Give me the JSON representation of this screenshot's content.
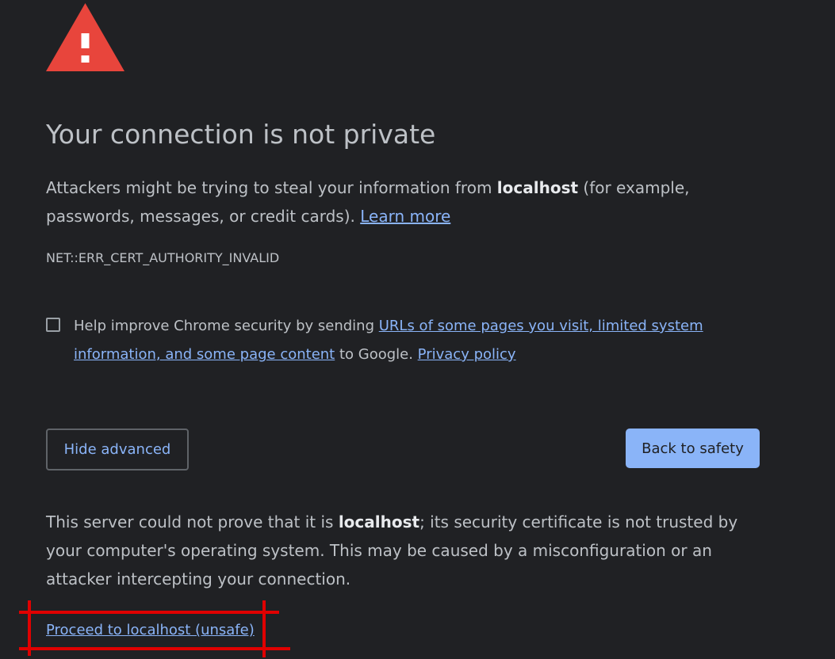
{
  "page": {
    "icon": "warning-triangle-icon",
    "title": "Your connection is not private",
    "intro": {
      "prefix": "Attackers might be trying to steal your information from ",
      "host": "localhost",
      "suffix": " (for example, passwords, messages, or credit cards). ",
      "learn_more": "Learn more"
    },
    "error_code": "NET::ERR_CERT_AUTHORITY_INVALID",
    "checkbox": {
      "checked": false,
      "prefix": "Help improve Chrome security by sending ",
      "link1": "URLs of some pages you visit, limited system information, and some page content",
      "middle": " to Google. ",
      "link2": "Privacy policy"
    },
    "buttons": {
      "hide_advanced": "Hide advanced",
      "back_to_safety": "Back to safety"
    },
    "details": {
      "prefix": "This server could not prove that it is ",
      "host": "localhost",
      "suffix": "; its security certificate is not trusted by your computer's operating system. This may be caused by a misconfiguration or an attacker intercepting your connection."
    },
    "proceed_link": "Proceed to localhost (unsafe)"
  },
  "colors": {
    "background": "#202124",
    "text": "#bdc1c6",
    "link": "#8ab4f8",
    "warning_red": "#e8453c",
    "annotation_red": "#e00000"
  }
}
